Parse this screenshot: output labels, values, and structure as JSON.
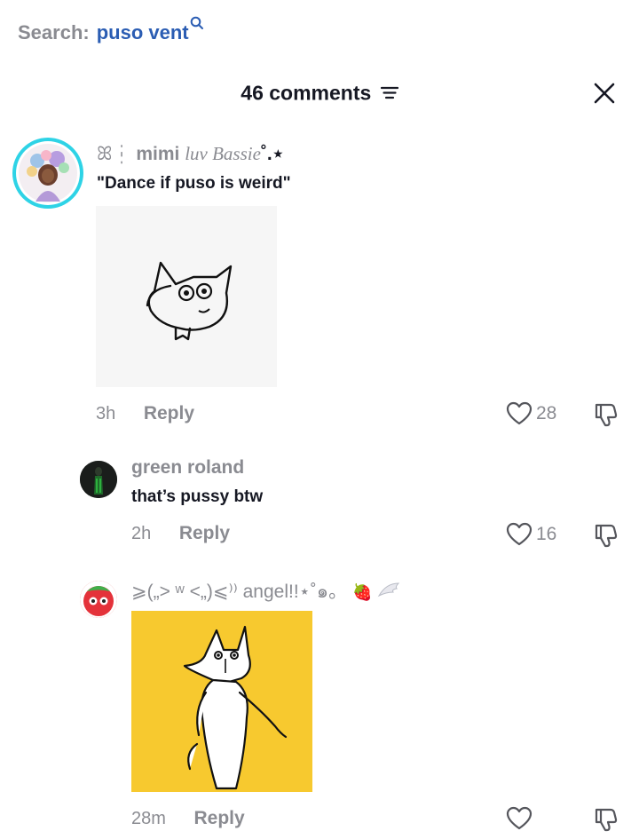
{
  "search": {
    "label": "Search:",
    "query": "puso vent",
    "icon": "search-icon"
  },
  "header": {
    "title": "46 comments",
    "filter_icon": "filter-icon",
    "close_icon": "close-icon"
  },
  "comments": [
    {
      "username_prefix": "ꕤ┆",
      "username_main": "mimi",
      "username_italic": "luv Bassie",
      "username_suffix": "˚.⋆",
      "text": "\"Dance if puso is weird\"",
      "time": "3h",
      "reply": "Reply",
      "likes": "28"
    },
    {
      "username": "green roland",
      "text": "that’s pussy btw",
      "time": "2h",
      "reply": "Reply",
      "likes": "16"
    },
    {
      "username": "⩾(„> ʷ <„)⩽⁾⁾ angel!!⋆˚๑。",
      "username_emoji": "🍓",
      "time": "28m",
      "reply": "Reply",
      "likes": ""
    }
  ],
  "colors": {
    "accent_blue": "#2b5db3",
    "muted": "#8a8b91",
    "text": "#161823",
    "yellow": "#f7c92f"
  }
}
